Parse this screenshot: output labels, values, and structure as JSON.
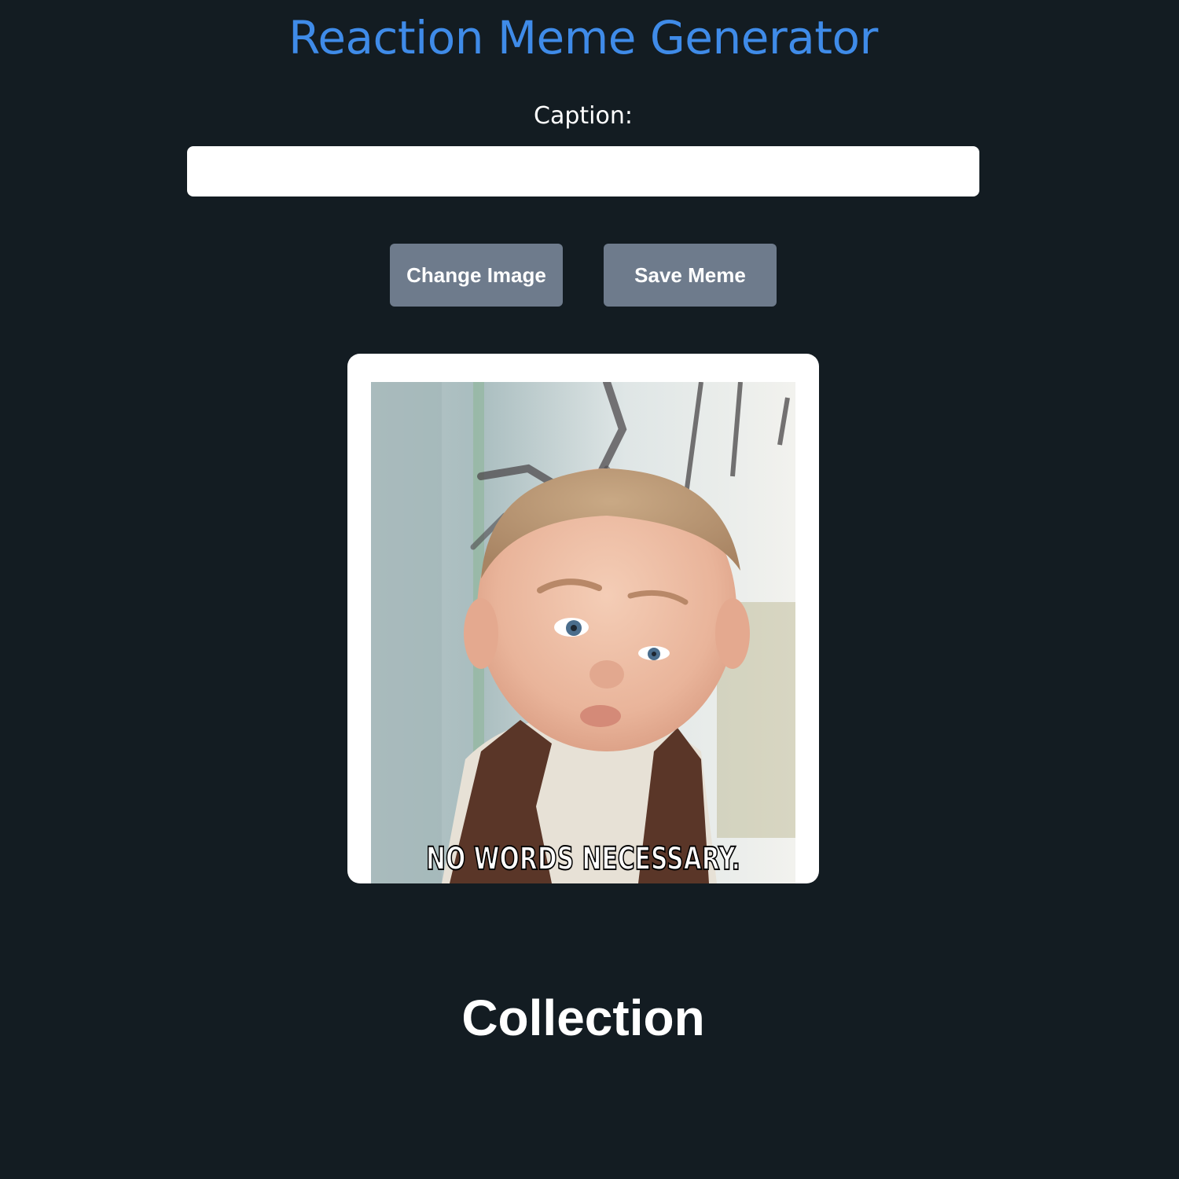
{
  "app": {
    "title": "Reaction Meme Generator"
  },
  "caption": {
    "label": "Caption:",
    "value": "",
    "placeholder": ""
  },
  "buttons": {
    "change_image": "Change Image",
    "save_meme": "Save Meme"
  },
  "meme": {
    "overlay_text": "NO WORDS NECESSARY."
  },
  "collection": {
    "heading": "Collection"
  },
  "colors": {
    "background": "#131c22",
    "title": "#3f8be8",
    "button": "#6e7b8c"
  }
}
